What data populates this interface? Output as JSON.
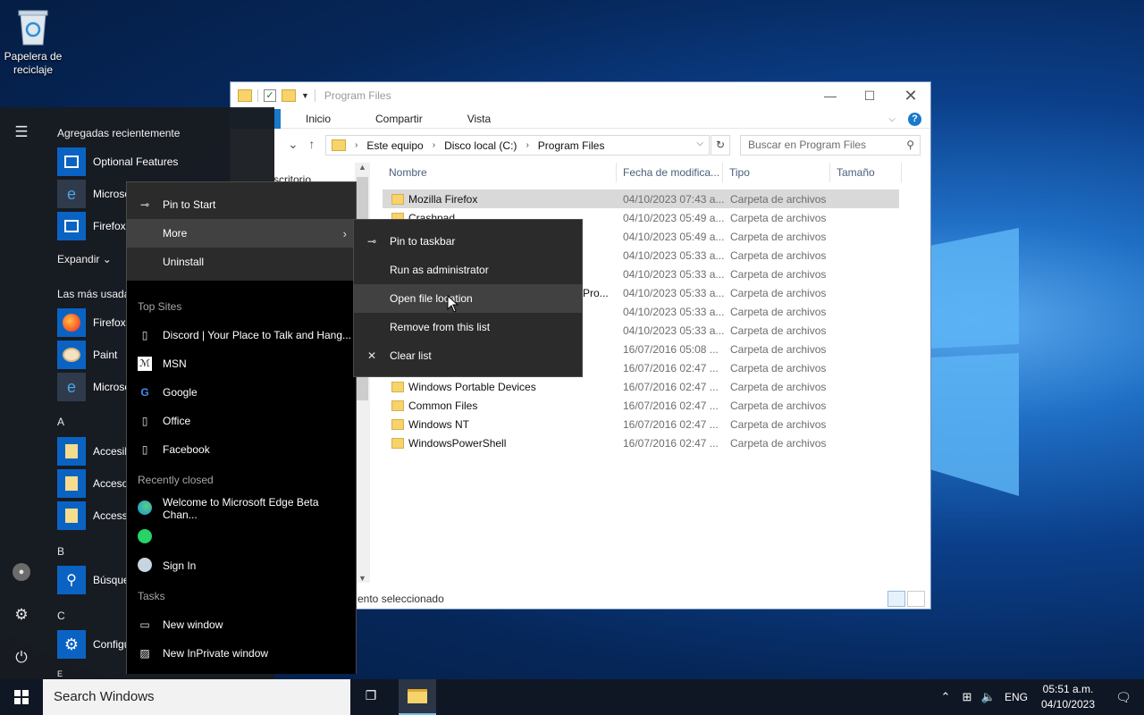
{
  "desktop": {
    "recycle_bin_label": "Papelera de reciclaje"
  },
  "explorer": {
    "title": "Program Files",
    "ribbon_tabs": [
      "Inicio",
      "Compartir",
      "Vista"
    ],
    "breadcrumbs": [
      "Este equipo",
      "Disco local (C:)",
      "Program Files"
    ],
    "search_placeholder": "Buscar en Program Files",
    "nav_pane_fragment": "scritorio",
    "columns": [
      "Nombre",
      "Fecha de modifica...",
      "Tipo",
      "Tamaño"
    ],
    "files": [
      {
        "name": "Mozilla Firefox",
        "date": "04/10/2023 07:43 a...",
        "type": "Carpeta de archivos"
      },
      {
        "name": "Crashpad",
        "date": "04/10/2023 05:49 a...",
        "type": "Carpeta de archivos"
      },
      {
        "name": "",
        "date": "04/10/2023 05:49 a...",
        "type": "Carpeta de archivos"
      },
      {
        "name": "",
        "date": "04/10/2023 05:33 a...",
        "type": "Carpeta de archivos"
      },
      {
        "name": "",
        "date": "04/10/2023 05:33 a...",
        "type": "Carpeta de archivos"
      },
      {
        "name": "Pro...",
        "date": "04/10/2023 05:33 a...",
        "type": "Carpeta de archivos"
      },
      {
        "name": "",
        "date": "04/10/2023 05:33 a...",
        "type": "Carpeta de archivos"
      },
      {
        "name": "",
        "date": "04/10/2023 05:33 a...",
        "type": "Carpeta de archivos"
      },
      {
        "name": "",
        "date": "16/07/2016 05:08 ...",
        "type": "Carpeta de archivos"
      },
      {
        "name": "",
        "date": "16/07/2016 02:47 ...",
        "type": "Carpeta de archivos"
      },
      {
        "name": "Windows Portable Devices",
        "date": "16/07/2016 02:47 ...",
        "type": "Carpeta de archivos"
      },
      {
        "name": "Common Files",
        "date": "16/07/2016 02:47 ...",
        "type": "Carpeta de archivos"
      },
      {
        "name": "Windows NT",
        "date": "16/07/2016 02:47 ...",
        "type": "Carpeta de archivos"
      },
      {
        "name": "WindowsPowerShell",
        "date": "16/07/2016 02:47 ...",
        "type": "Carpeta de archivos"
      }
    ],
    "status": "ento seleccionado"
  },
  "start_menu": {
    "recently_added_header": "Agregadas recientemente",
    "recent_apps": [
      "Optional Features",
      "Microso",
      "Firefox"
    ],
    "expand_label": "Expandir",
    "most_used_header": "Las más usadas",
    "most_used_apps": [
      "Firefox",
      "Paint",
      "Microso"
    ],
    "letters": [
      "A",
      "B",
      "C",
      "E"
    ],
    "a_apps": [
      "Accesib",
      "Acceso",
      "Accesso"
    ],
    "b_apps": [
      "Búsque"
    ],
    "c_apps": [
      "Configu"
    ]
  },
  "context_menu": {
    "items": [
      "Pin to Start",
      "More",
      "Uninstall"
    ],
    "top_sites_header": "Top Sites",
    "top_sites": [
      "Discord | Your Place to Talk and Hang...",
      "MSN",
      "Google",
      "Office",
      "Facebook"
    ],
    "recently_closed_header": "Recently closed",
    "recently_closed": [
      "Welcome to Microsoft Edge Beta Chan...",
      "",
      "Sign In"
    ],
    "tasks_header": "Tasks",
    "tasks": [
      "New window",
      "New InPrivate window"
    ]
  },
  "submenu": {
    "items": [
      "Pin to taskbar",
      "Run as administrator",
      "Open file location",
      "Remove from this list",
      "Clear list"
    ]
  },
  "taskbar": {
    "search_placeholder": "Search Windows",
    "lang": "ENG",
    "time": "05:51 a.m.",
    "date": "04/10/2023"
  },
  "colors": {
    "accent": "#0a63c2",
    "taskbar": "#101724",
    "menu_bg": "#2b2b2b"
  }
}
